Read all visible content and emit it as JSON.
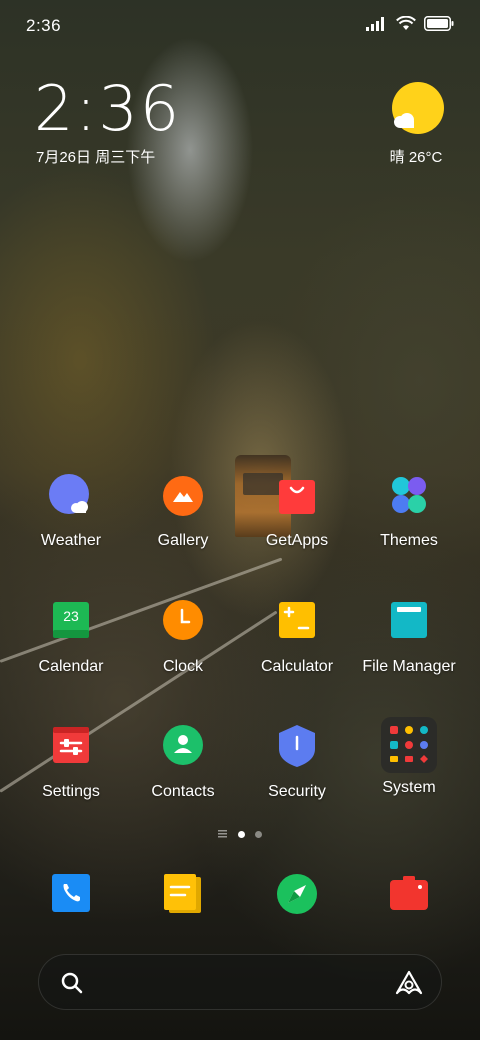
{
  "status_bar": {
    "time": "2:36"
  },
  "clock_widget": {
    "time": "2:36",
    "date": "7月26日 周三下午"
  },
  "weather_widget": {
    "condition": "晴",
    "temperature": "26°C"
  },
  "apps": [
    {
      "label": "Weather",
      "icon": "weather-icon"
    },
    {
      "label": "Gallery",
      "icon": "gallery-icon"
    },
    {
      "label": "GetApps",
      "icon": "getapps-icon"
    },
    {
      "label": "Themes",
      "icon": "themes-icon"
    },
    {
      "label": "Calendar",
      "icon": "calendar-icon",
      "badge": "23"
    },
    {
      "label": "Clock",
      "icon": "clock-icon"
    },
    {
      "label": "Calculator",
      "icon": "calculator-icon"
    },
    {
      "label": "File Manager",
      "icon": "file-manager-icon"
    },
    {
      "label": "Settings",
      "icon": "settings-icon"
    },
    {
      "label": "Contacts",
      "icon": "contacts-icon"
    },
    {
      "label": "Security",
      "icon": "security-icon"
    },
    {
      "label": "System",
      "icon": "system-folder-icon"
    }
  ],
  "page_indicator": {
    "pages": 2,
    "current": 1
  },
  "dock": [
    {
      "icon": "phone-icon"
    },
    {
      "icon": "notes-icon"
    },
    {
      "icon": "browser-icon"
    },
    {
      "icon": "camera-icon"
    }
  ],
  "search_bar": {
    "left_icon": "search-icon",
    "right_icon": "assistant-icon"
  },
  "colors": {
    "weather": "#6b7cf5",
    "gallery": "#ff6a13",
    "getapps": "#ff3b3b",
    "calendar": "#1db954",
    "clock": "#ff8c00",
    "calculator": "#ffbf00",
    "file_manager": "#13b8c6",
    "settings": "#f03a3a",
    "contacts": "#1cc06a",
    "security": "#5c7cf0",
    "phone": "#1a8cf5",
    "notes": "#ffc107",
    "browser": "#1bc15d",
    "camera": "#f2352e",
    "sun": "#ffd21a"
  }
}
